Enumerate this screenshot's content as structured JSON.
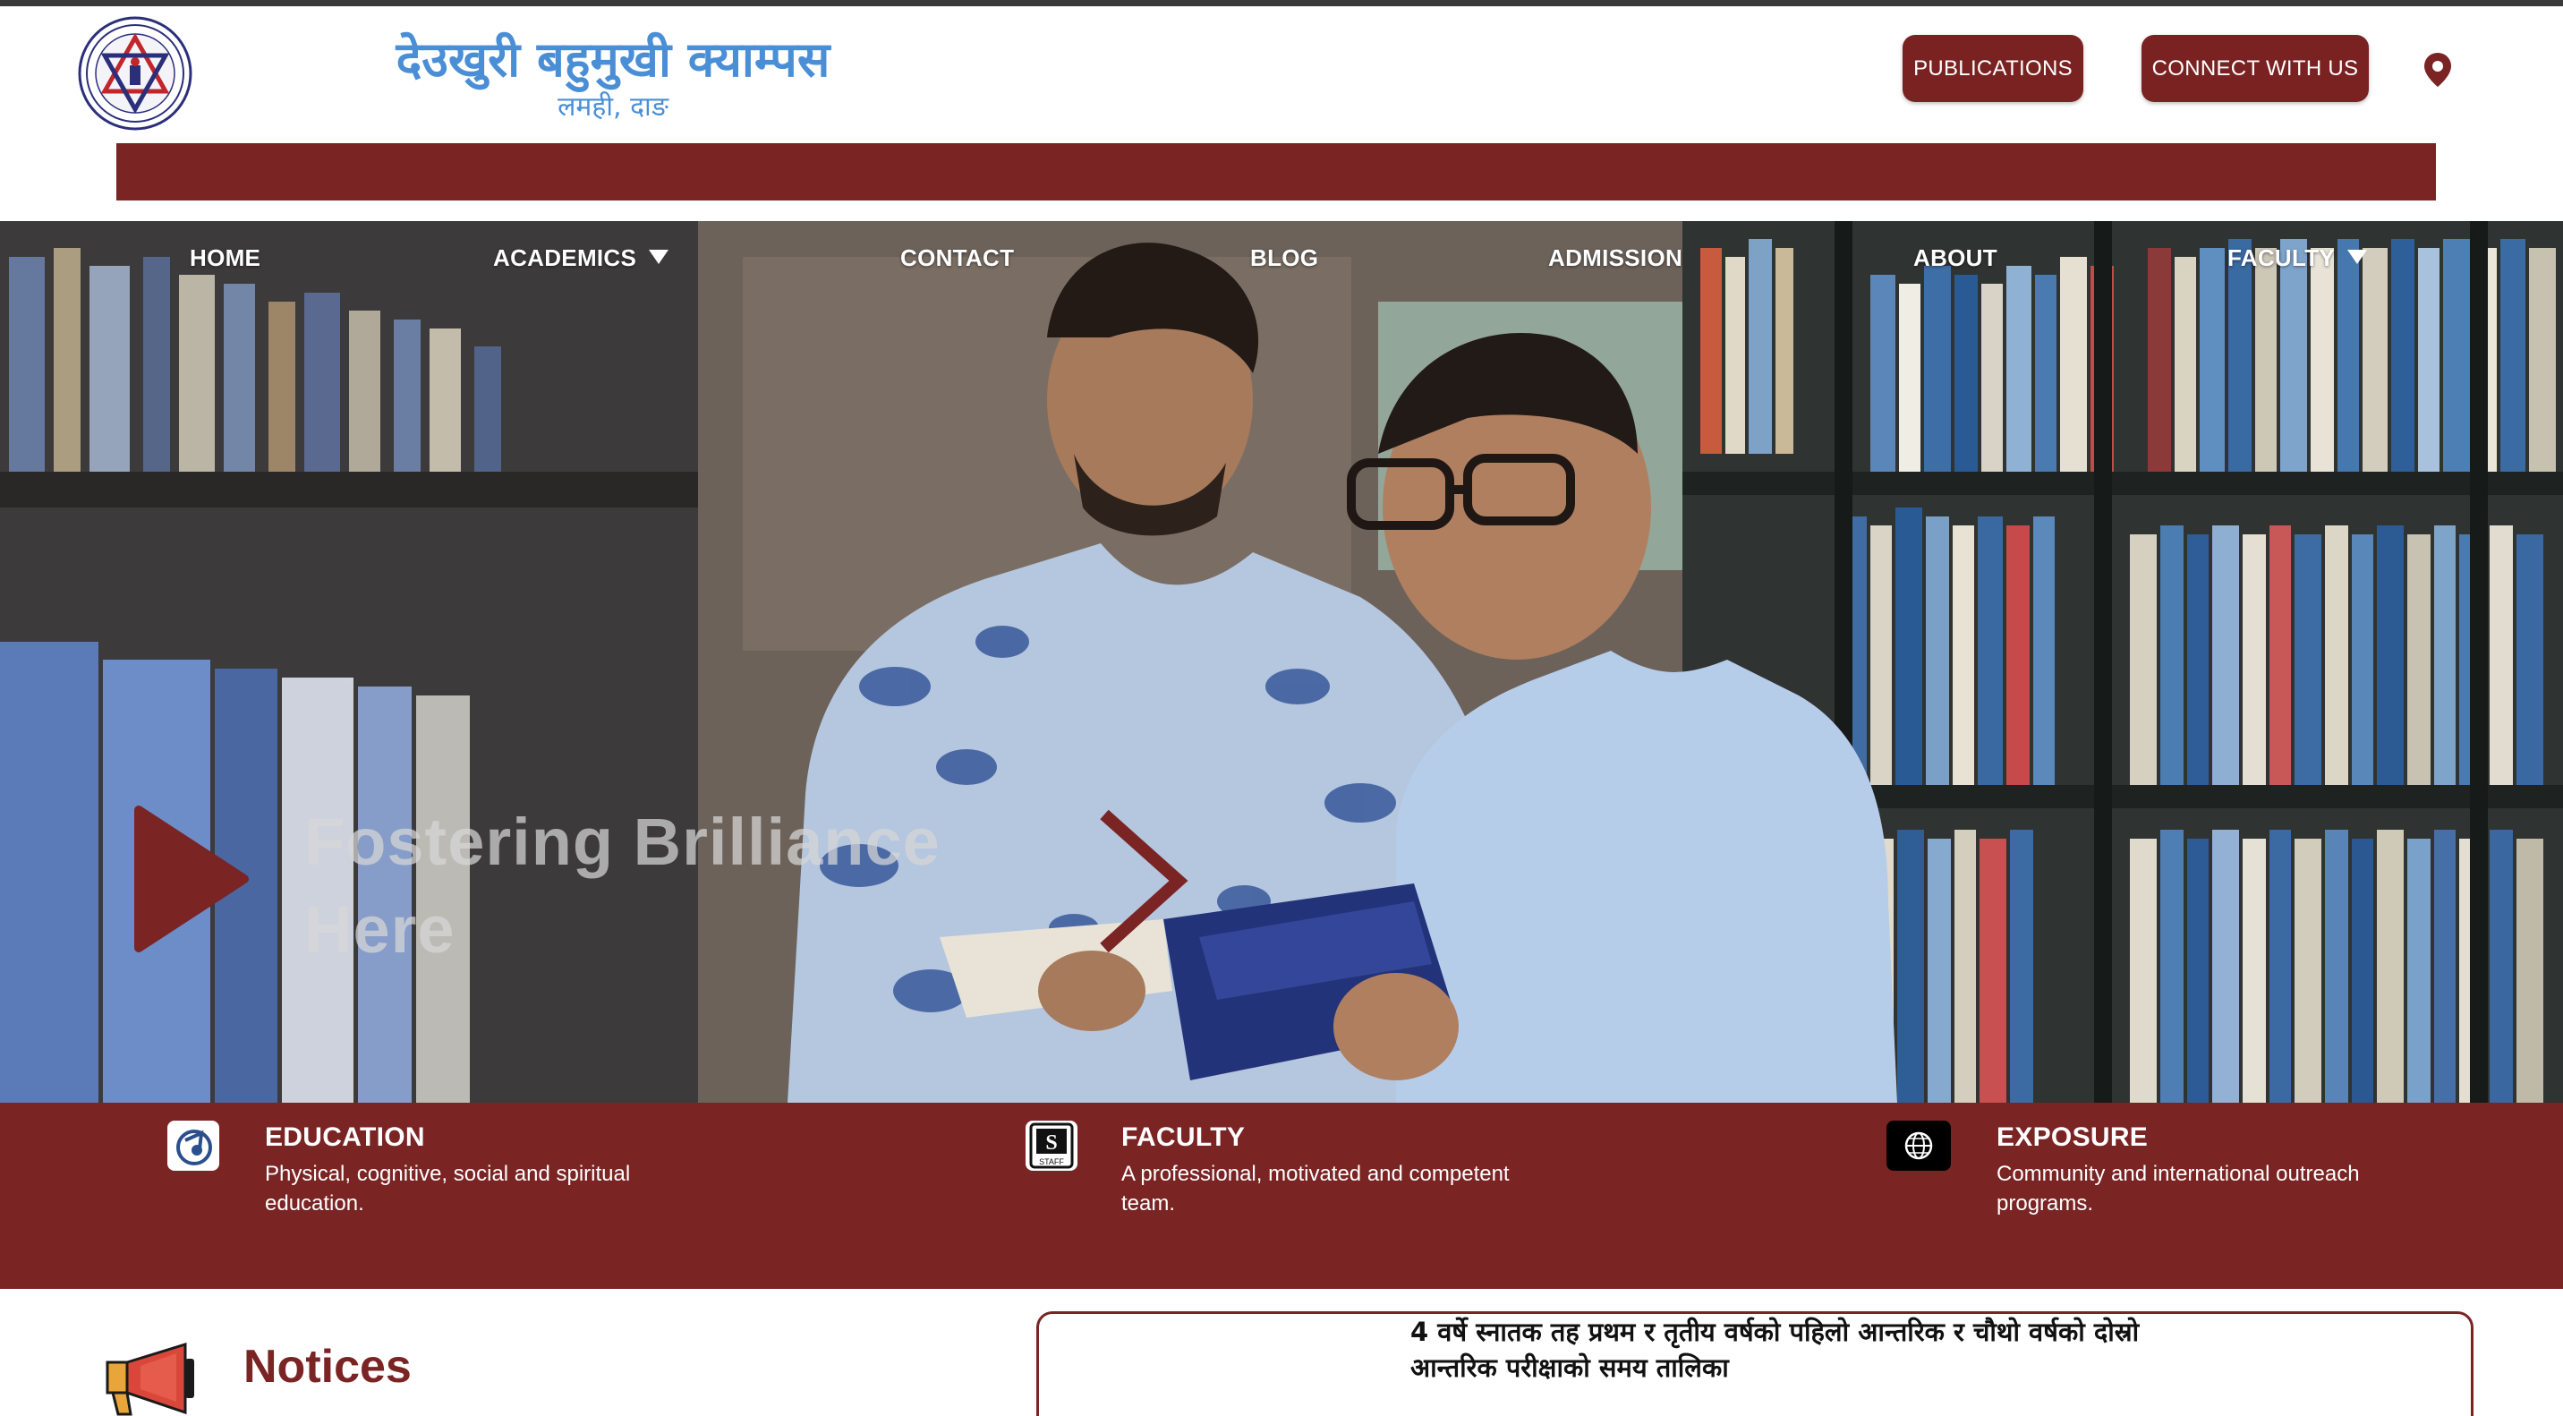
{
  "header": {
    "college_name": "देउखुरी बहुमुखी क्याम्पस",
    "college_place": "लमही, दाङ",
    "publications_label": "PUBLICATIONS",
    "connect_label": "CONNECT WITH US",
    "location_icon": "map-pin-icon",
    "logo_icon": "college-emblem"
  },
  "nav": {
    "items": [
      {
        "label": "HOME"
      },
      {
        "label": "ACADEMICS",
        "dropdown": true
      },
      {
        "label": "CONTACT"
      },
      {
        "label": "BLOG"
      },
      {
        "label": "ADMISSION"
      },
      {
        "label": "ABOUT"
      },
      {
        "label": "FACULTY",
        "dropdown": true
      }
    ]
  },
  "hero": {
    "title_line1": "Fostering Brilliance",
    "title_line2": "Here",
    "play_icon": "play-icon",
    "next_icon": "chevron-right-icon"
  },
  "features": [
    {
      "title": "EDUCATION",
      "desc": "Physical, cognitive, social and spiritual education.",
      "icon": "education-icon"
    },
    {
      "title": "FACULTY",
      "desc": "A professional, motivated and competent team.",
      "icon": "staff-icon"
    },
    {
      "title": "EXPOSURE",
      "desc": "Community and international outreach programs.",
      "icon": "globe-icon"
    }
  ],
  "notices": {
    "title": "Notices",
    "icon": "megaphone-icon",
    "first_notice": "4 वर्षे स्नातक तह प्रथम र तृतीय वर्षको पहिलो आन्तरिक र चौथो वर्षको दोस्रो आन्तरिक परीक्षाको समय तालिका"
  },
  "colors": {
    "brand_maroon": "#7a2424",
    "title_blue": "#4a8fd6"
  }
}
